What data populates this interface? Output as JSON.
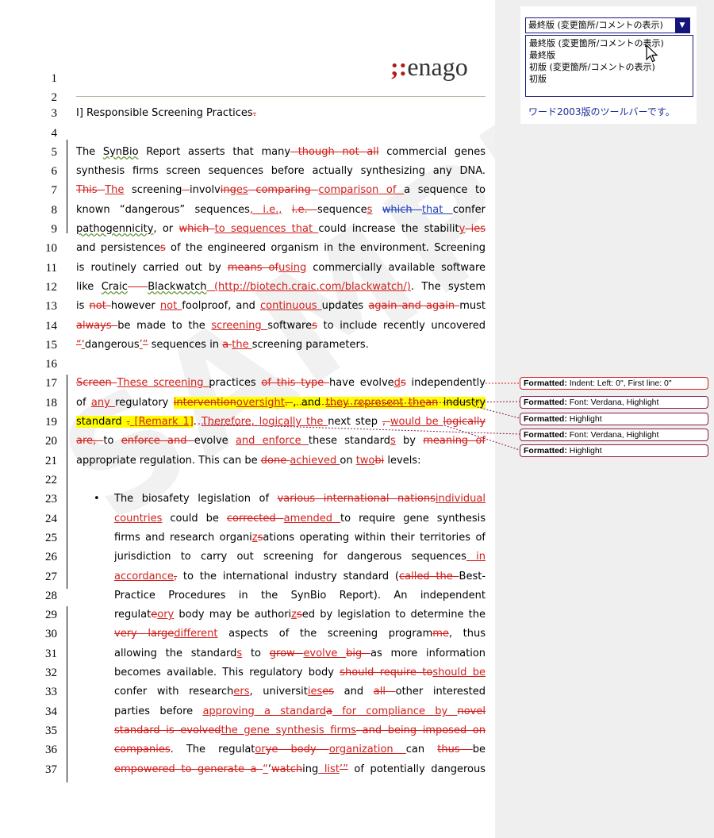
{
  "logo": {
    "text": "enago",
    "mark": ";:"
  },
  "watermark": "SAMPLE",
  "toolbar": {
    "selected": "最終版 (変更箇所/コメントの表示)",
    "options": [
      "最終版 (変更箇所/コメントの表示)",
      "最終版",
      "初版 (変更箇所/コメントの表示)",
      "初版"
    ],
    "caption": "ワード2003版のツールバーです。"
  },
  "balloons": [
    {
      "label": "Formatted:",
      "text": "Indent: Left:  0\", First line:  0\""
    },
    {
      "label": "Formatted:",
      "text": "Font: Verdana, Highlight"
    },
    {
      "label": "Formatted:",
      "text": "Highlight"
    },
    {
      "label": "Formatted:",
      "text": "Font: Verdana, Highlight"
    },
    {
      "label": "Formatted:",
      "text": "Highlight"
    }
  ],
  "line_numbers": [
    "1",
    "2",
    "3",
    "4",
    "5",
    "6",
    "7",
    "8",
    "9",
    "10",
    "11",
    "12",
    "13",
    "14",
    "15",
    "16",
    "17",
    "18",
    "19",
    "20",
    "21",
    "22",
    "23",
    "24",
    "25",
    "26",
    "27",
    "28",
    "29",
    "30",
    "31",
    "32",
    "33",
    "34",
    "35",
    "36",
    "37"
  ],
  "heading": {
    "text": "I] Responsible  Screening Practices",
    "del": "."
  },
  "l5": [
    "The ",
    "SynBio",
    " Report asserts that many",
    " though not all",
    " commercial genes"
  ],
  "l6": [
    "synthesis firms screen sequences before actually synthesizing any DNA."
  ],
  "l7": [
    "This ",
    "The",
    " screening",
    " ",
    "involv",
    "ing",
    "es",
    " comparing ",
    "comparison of ",
    "a sequence to"
  ],
  "l8": [
    "known “dangerous” sequences",
    ", i.e.,",
    " ",
    "i.e. ",
    "sequence",
    "s",
    " ",
    "which ",
    "that ",
    "confer"
  ],
  "l9": [
    "pathogennicity",
    ", or ",
    "which ",
    "to sequences that ",
    "could increase the stabilit",
    "y",
    " ies"
  ],
  "l10": [
    "and persistence",
    "s",
    " of the engineered organism in the environment. Screening"
  ],
  "l11": [
    "is routinely carried out by ",
    "means of",
    "using",
    " commercially available software"
  ],
  "l12": [
    "like ",
    "Craic",
    " – ",
    "Blackwatch",
    " (http://biotech.craic.com/blackwatch/)",
    ". The system"
  ],
  "l13": [
    "is ",
    "not ",
    "however ",
    "not ",
    "foolproof, and ",
    "continuous ",
    "updates ",
    "again and again ",
    "must"
  ],
  "l14": [
    "always ",
    "be made to the ",
    "screening ",
    "software",
    "s",
    " to include recently uncovered"
  ],
  "l15": [
    "“",
    "‘",
    "dangerous",
    "’",
    "”",
    " sequences in ",
    "a ",
    "the ",
    "screening parameters."
  ],
  "l17": [
    "Screen ",
    "These screening ",
    "practices ",
    "of this type ",
    "have evolve",
    "d",
    "s",
    " independently"
  ],
  "l18": [
    "of ",
    "any ",
    "regulatory ",
    "intervention",
    "oversight",
    ". ",
    ", and ",
    "they represent th",
    "e",
    "an",
    " industry"
  ],
  "l19": [
    "standard",
    " ",
    ".",
    " [Remark 1]",
    ". ",
    "There",
    "fore, logically the ",
    "next step ",
    ", ",
    "would be ",
    "logically"
  ],
  "l20": [
    "are, ",
    "to ",
    "enforce and ",
    "evolve ",
    "and enforce ",
    "these standard",
    "s",
    " by ",
    "meaning of"
  ],
  "l21": [
    "appropriate regulation. This can be ",
    "done ",
    "achieved ",
    "on ",
    "two",
    "bi",
    " levels:"
  ],
  "l23": [
    "•",
    "The biosafety legislation of ",
    "various international nations",
    "individual"
  ],
  "l24": [
    "countries",
    " could be ",
    "corrected ",
    "amended ",
    "to require gene synthesis"
  ],
  "l25": [
    "firms and research organi",
    "z",
    "s",
    "ations operating within their territories of"
  ],
  "l26": [
    "jurisdiction to carry out screening for dangerous sequences",
    " in"
  ],
  "l27": [
    "accordance",
    ",",
    " to the international industry standard (",
    "called the ",
    "Best-"
  ],
  "l28": [
    "Practice  Procedures  in  the  SynBio  Report).  An  independent"
  ],
  "l29": [
    "regulat",
    "e",
    "ory",
    " body may be authori",
    "z",
    "s",
    "ed by legislation to determine the"
  ],
  "l30": [
    "very large",
    "different",
    " aspects of the screening program",
    "me",
    ", thus"
  ],
  "l31": [
    "allowing the standard",
    "s",
    " to ",
    "grow ",
    "evolve ",
    "big ",
    "as more information"
  ],
  "l32": [
    "becomes available. This regulatory body ",
    "should require to",
    "should be"
  ],
  "l33": [
    "confer with research",
    "ers",
    ", universit",
    "ies",
    "es",
    " and ",
    "all ",
    "other interested"
  ],
  "l34": [
    "parties before ",
    "approving a standard",
    "a",
    " for compliance by ",
    "novel"
  ],
  "l35": [
    "standard is evolved",
    "the gene synthesis firms",
    " and being imposed on"
  ],
  "l36": [
    "companies",
    ". The regulat",
    "or",
    "y",
    "e",
    " body ",
    "organization ",
    "can ",
    "thus ",
    "be"
  ],
  "l37": [
    "empowered to generate a ",
    "“",
    "‘",
    "watch",
    "ing",
    " list",
    "’",
    "”",
    " of potentially dangerous"
  ]
}
